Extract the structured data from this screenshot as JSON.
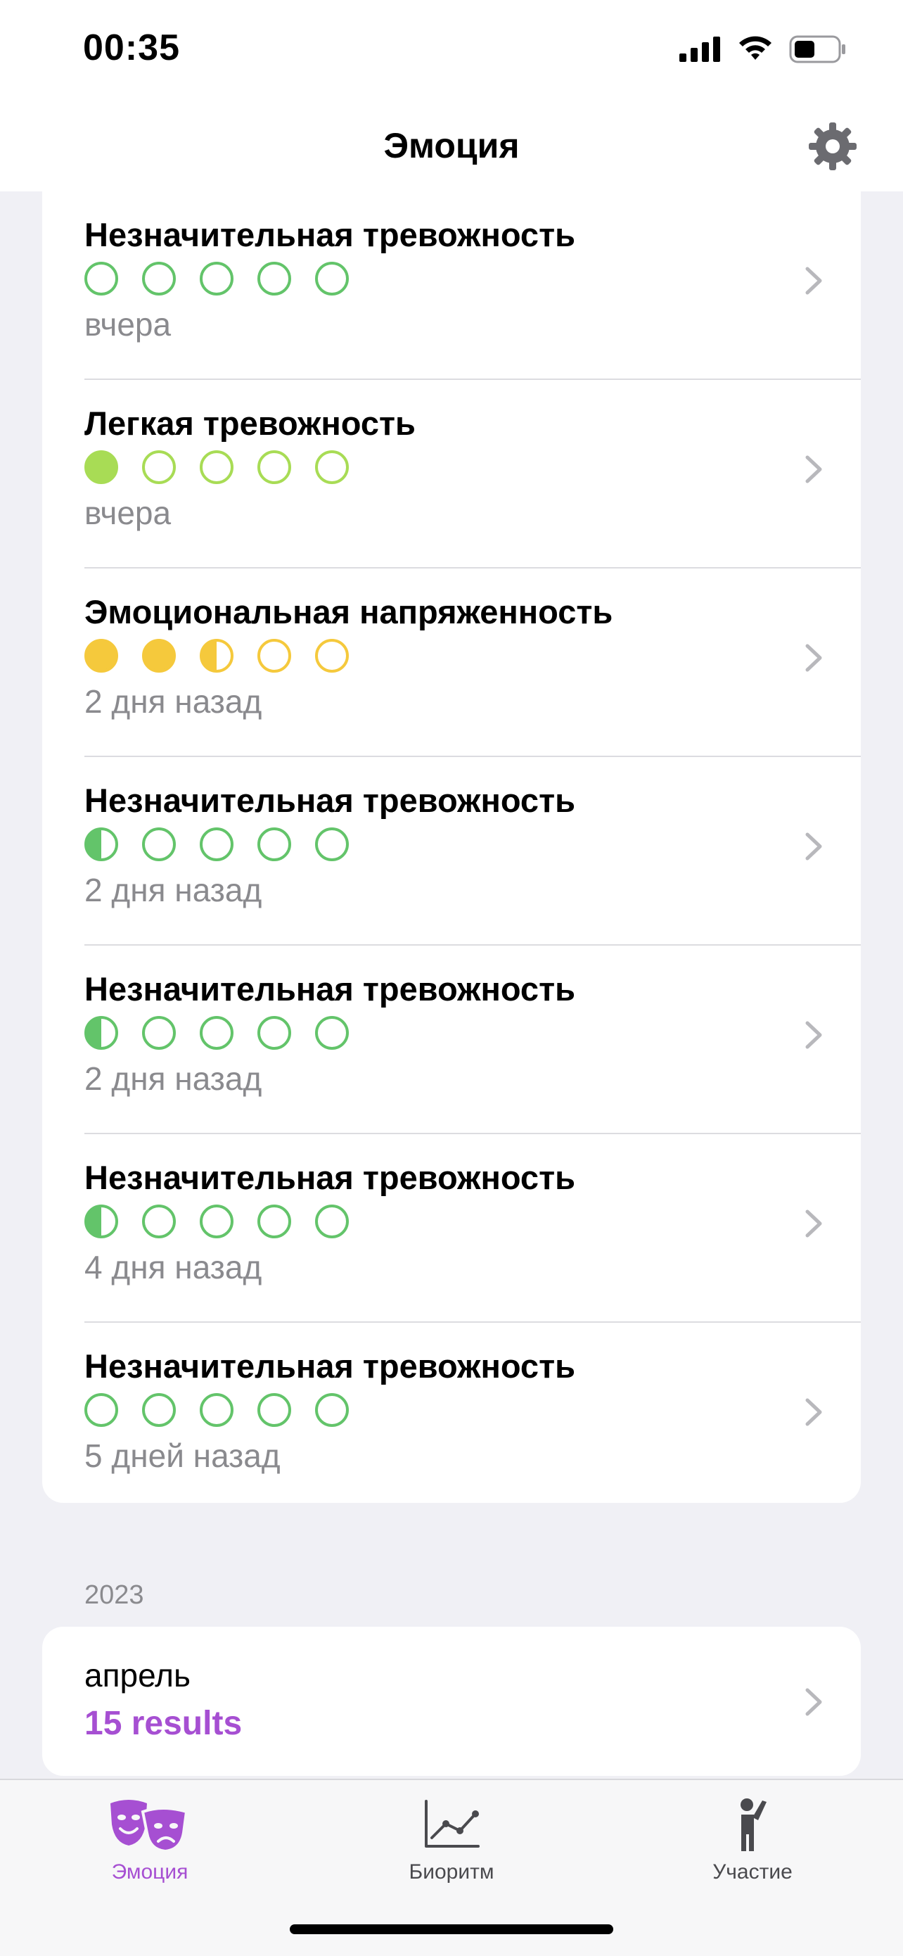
{
  "status_bar": {
    "time": "00:35"
  },
  "header": {
    "title": "Эмоция",
    "settings_icon": "gear-icon"
  },
  "entries": [
    {
      "title": "Незначительная тревожность",
      "time": "вчера",
      "color": "#63c46a",
      "dots": [
        "empty",
        "empty",
        "empty",
        "empty",
        "empty"
      ]
    },
    {
      "title": "Легкая тревожность",
      "time": "вчера",
      "color": "#a8dc55",
      "dots": [
        "full",
        "empty",
        "empty",
        "empty",
        "empty"
      ]
    },
    {
      "title": "Эмоциональная напряженность",
      "time": "2 дня назад",
      "color": "#f5c93c",
      "dots": [
        "full",
        "full",
        "half",
        "empty",
        "empty"
      ]
    },
    {
      "title": "Незначительная тревожность",
      "time": "2 дня назад",
      "color": "#63c46a",
      "dots": [
        "half",
        "empty",
        "empty",
        "empty",
        "empty"
      ]
    },
    {
      "title": "Незначительная тревожность",
      "time": "2 дня назад",
      "color": "#63c46a",
      "dots": [
        "half",
        "empty",
        "empty",
        "empty",
        "empty"
      ]
    },
    {
      "title": "Незначительная тревожность",
      "time": "4 дня назад",
      "color": "#63c46a",
      "dots": [
        "half",
        "empty",
        "empty",
        "empty",
        "empty"
      ]
    },
    {
      "title": "Незначительная тревожность",
      "time": "5 дней назад",
      "color": "#63c46a",
      "dots": [
        "empty",
        "empty",
        "empty",
        "empty",
        "empty"
      ]
    }
  ],
  "section": {
    "year": "2023"
  },
  "month_card": {
    "label": "апрель",
    "results": "15 results"
  },
  "tabs": [
    {
      "label": "Эмоция",
      "icon": "theater-masks-icon",
      "active": true
    },
    {
      "label": "Биоритм",
      "icon": "line-chart-icon",
      "active": false
    },
    {
      "label": "Участие",
      "icon": "person-raising-hand-icon",
      "active": false
    }
  ],
  "colors": {
    "accent": "#a64fd2",
    "secondary_text": "#8a8a8e"
  }
}
